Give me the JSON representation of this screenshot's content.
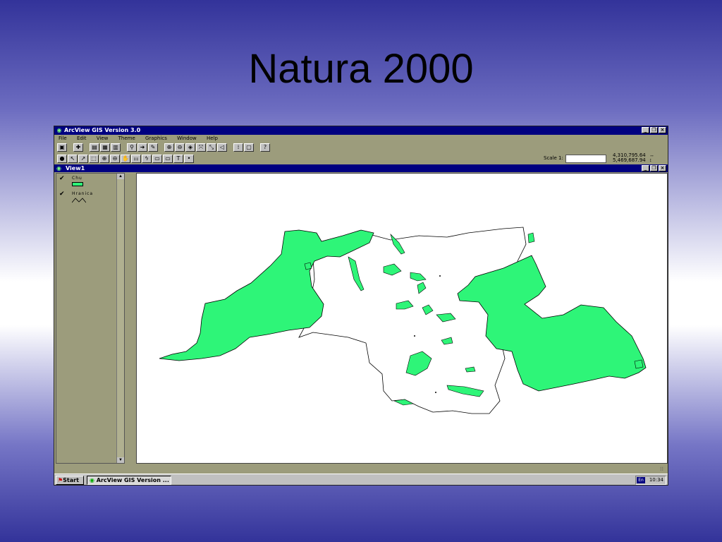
{
  "slide": {
    "title": "Natura 2000"
  },
  "app": {
    "title": "ArcView GIS Version 3.0",
    "menu": [
      "File",
      "Edit",
      "View",
      "Theme",
      "Graphics",
      "Window",
      "Help"
    ],
    "toolbar_icons": [
      "save-icon",
      "add-theme-icon",
      "properties-icon",
      "table-icon",
      "chart-icon",
      "find-icon",
      "locate-icon",
      "query-icon",
      "zoom-full-icon",
      "zoom-active-icon",
      "zoom-selected-icon",
      "zoom-in-icon",
      "zoom-out-icon",
      "previous-extent-icon",
      "select-features-icon",
      "clear-selection-icon",
      "help-icon"
    ],
    "tool_icons": [
      "identify-icon",
      "pointer-icon",
      "vertex-edit-icon",
      "select-feature-icon",
      "zoom-in-tool-icon",
      "zoom-out-tool-icon",
      "pan-icon",
      "measure-icon",
      "hotlink-icon",
      "area-of-interest-icon",
      "label-icon",
      "text-icon",
      "draw-icon"
    ],
    "scale_label": "Scale 1:",
    "scale_value": "",
    "coord_x": "4,310,795.64",
    "coord_y": "5,469,687.94"
  },
  "view": {
    "title": "View1",
    "legend": [
      {
        "name": "Chu",
        "type": "polygon",
        "color": "#2ef578",
        "checked": true
      },
      {
        "name": "Hranica",
        "type": "line",
        "checked": true
      }
    ]
  },
  "taskbar": {
    "start_label": "Start",
    "task_label": "ArcView GIS Version ...",
    "lang": "En",
    "clock": "10:34"
  },
  "colors": {
    "habitat_fill": "#2ef578",
    "titlebar": "#000080",
    "window_bg": "#9c9c7c"
  }
}
